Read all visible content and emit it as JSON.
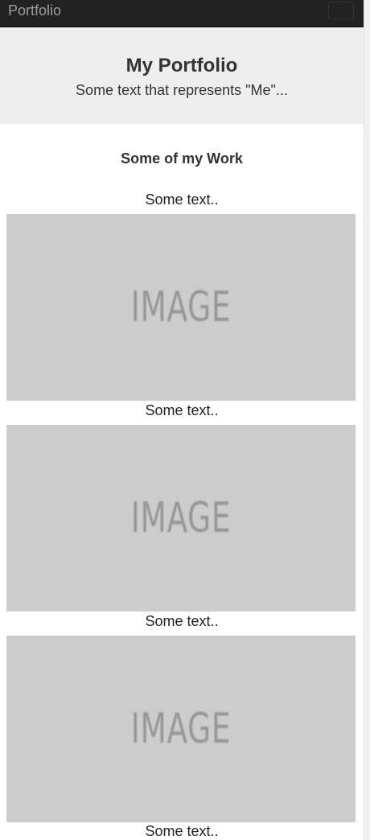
{
  "navbar": {
    "brand": "Portfolio"
  },
  "jumbotron": {
    "title": "My Portfolio",
    "subtitle": "Some text that represents \"Me\"..."
  },
  "work": {
    "heading": "Some of my Work",
    "items": [
      {
        "caption": "Some text..",
        "image_label": "IMAGE"
      },
      {
        "caption": "Some text..",
        "image_label": "IMAGE"
      },
      {
        "caption": "Some text..",
        "image_label": "IMAGE"
      },
      {
        "caption": "Some text.."
      }
    ]
  },
  "colors": {
    "navbar_bg": "#222222",
    "brand_text": "#9d9d9d",
    "jumbotron_bg": "#eeeeee",
    "image_placeholder_bg": "#cccccc",
    "image_label_text": "#979797"
  }
}
